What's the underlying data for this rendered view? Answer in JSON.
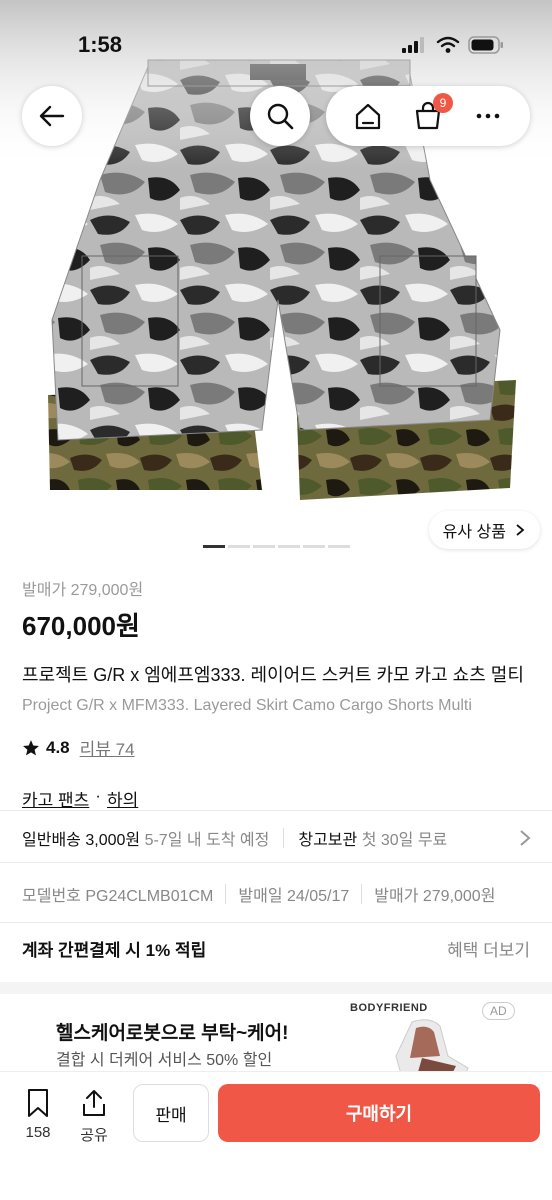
{
  "status_bar": {
    "time": "1:58"
  },
  "header": {
    "cart_count": "9"
  },
  "hero": {
    "similar_label": "유사 상품",
    "page_count": 6,
    "active_page": 1
  },
  "product": {
    "original_price": "발매가 279,000원",
    "price": "670,000원",
    "title_ko": "프로젝트 G/R x 엠에프엠333. 레이어드 스커트 카모 카고 쇼츠 멀티",
    "title_en": "Project G/R x MFM333. Layered Skirt Camo Cargo Shorts Multi",
    "rating": "4.8",
    "review_label": "리뷰 74",
    "category": "카고 팬츠",
    "category_sep": "·",
    "category_parent": "하의"
  },
  "shipping": {
    "label": "일반배송",
    "fee": "3,000원",
    "eta": "5-7일 내 도착 예정",
    "storage_label": "창고보관",
    "storage_desc": "첫 30일 무료"
  },
  "specs": {
    "model": "모델번호 PG24CLMB01CM",
    "release_date": "발매일 24/05/17",
    "release_price": "발매가 279,000원"
  },
  "payment": {
    "promo": "계좌 간편결제 시 1% 적립",
    "more": "혜택 더보기"
  },
  "ad": {
    "headline": "헬스케어로봇으로 부탁~케어!",
    "sub": "결합 시 더케어 서비스 50% 할인",
    "brand": "BODYFRIEND",
    "tag": "AD"
  },
  "bottom_bar": {
    "bookmark_count": "158",
    "share_label": "공유",
    "sell_label": "판매",
    "buy_label": "구매하기"
  },
  "colors": {
    "accent": "#f15746"
  }
}
